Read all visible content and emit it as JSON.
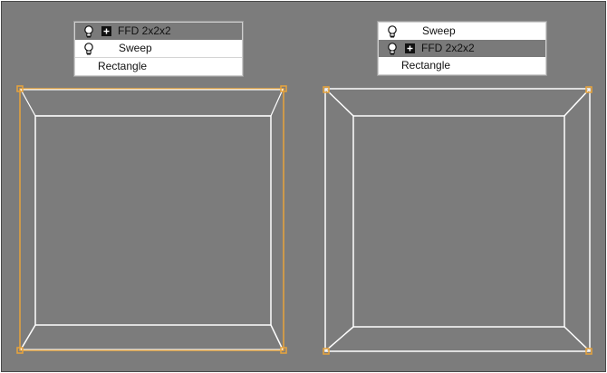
{
  "colors": {
    "viewport_bg": "#7c7c7c",
    "selection_lattice": "#e8a33b",
    "wireframe": "#ffffff",
    "selected_row": "#7a7a7a"
  },
  "left_panel": {
    "modifier_stack": [
      {
        "label": "FFD 2x2x2",
        "icon": "lightbulb-icon",
        "expand": "plus-icon",
        "selected": true
      },
      {
        "label": "Sweep",
        "icon": "lightbulb-icon",
        "selected": false
      },
      {
        "label": "Rectangle",
        "selected": false
      }
    ]
  },
  "right_panel": {
    "modifier_stack": [
      {
        "label": "Sweep",
        "icon": "lightbulb-icon",
        "selected": false
      },
      {
        "label": "FFD 2x2x2",
        "icon": "lightbulb-icon",
        "expand": "plus-icon",
        "selected": true
      },
      {
        "label": "Rectangle",
        "selected": false
      }
    ]
  }
}
